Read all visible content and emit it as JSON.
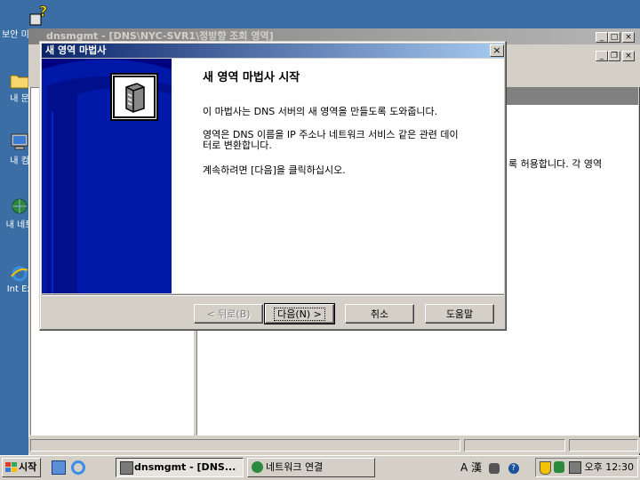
{
  "desktop": {
    "icons": [
      {
        "label": "보안 미주"
      },
      {
        "label": "내 문"
      },
      {
        "label": "내 컴"
      },
      {
        "label": "내 네트"
      },
      {
        "label": "Int Ex"
      }
    ]
  },
  "mmc": {
    "title": "dnsmgmt - [DNS\\NYC-SVR1\\정방향 조회 영역]",
    "right_pane_text": "록 허용합니다. 각 영역"
  },
  "wizard": {
    "title": "새 영역 마법사",
    "heading": "새 영역 마법사 시작",
    "para1": "이 마법사는 DNS 서버의 새 영역을 만들도록 도와줍니다.",
    "para2_line1": "영역은 DNS 이름을 IP 주소나 네트워크 서비스 같은 관련 데이",
    "para2_line2": "터로 변환합니다.",
    "para3": "계속하려면 [다음]을 클릭하십시오.",
    "buttons": {
      "back": "< 뒤로(B)",
      "next": "다음(N) >",
      "cancel": "취소",
      "help": "도움말"
    }
  },
  "taskbar": {
    "start": "시작",
    "tasks": [
      {
        "label": "dnsmgmt - [DNS..."
      },
      {
        "label": "네트워크 연결"
      }
    ],
    "ime": "A 漢",
    "clock": "오후 12:30"
  },
  "colors": {
    "desktop": "#3a6ea5",
    "title_active": "#0a246a",
    "title_inactive": "#808080",
    "banner": "#000080"
  }
}
